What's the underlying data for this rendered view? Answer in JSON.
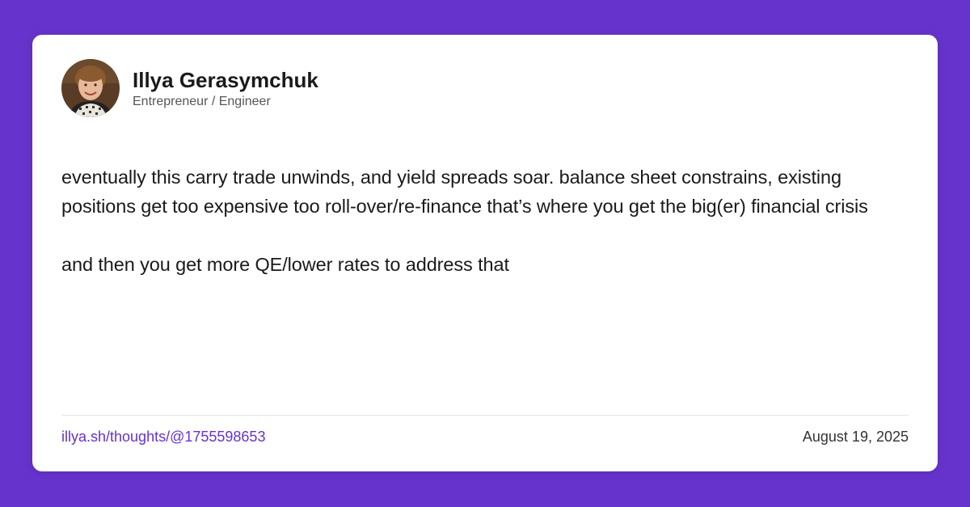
{
  "colors": {
    "background": "#6633cc",
    "card": "#ffffff",
    "text": "#1a1a1a",
    "muted": "#555555",
    "link": "#6633cc"
  },
  "author": {
    "name": "Illya Gerasymchuk",
    "role": "Entrepreneur / Engineer",
    "avatar_icon": "avatar-photo"
  },
  "post": {
    "paragraph_1": "eventually this carry trade unwinds, and yield spreads soar. balance sheet constrains, existing positions get too expensive too roll-over/re-finance that’s where you get the big(er) financial crisis",
    "paragraph_2": "and then you get more QE/lower rates to address that"
  },
  "footer": {
    "link_text": "illya.sh/thoughts/@1755598653",
    "date": "August 19, 2025"
  }
}
